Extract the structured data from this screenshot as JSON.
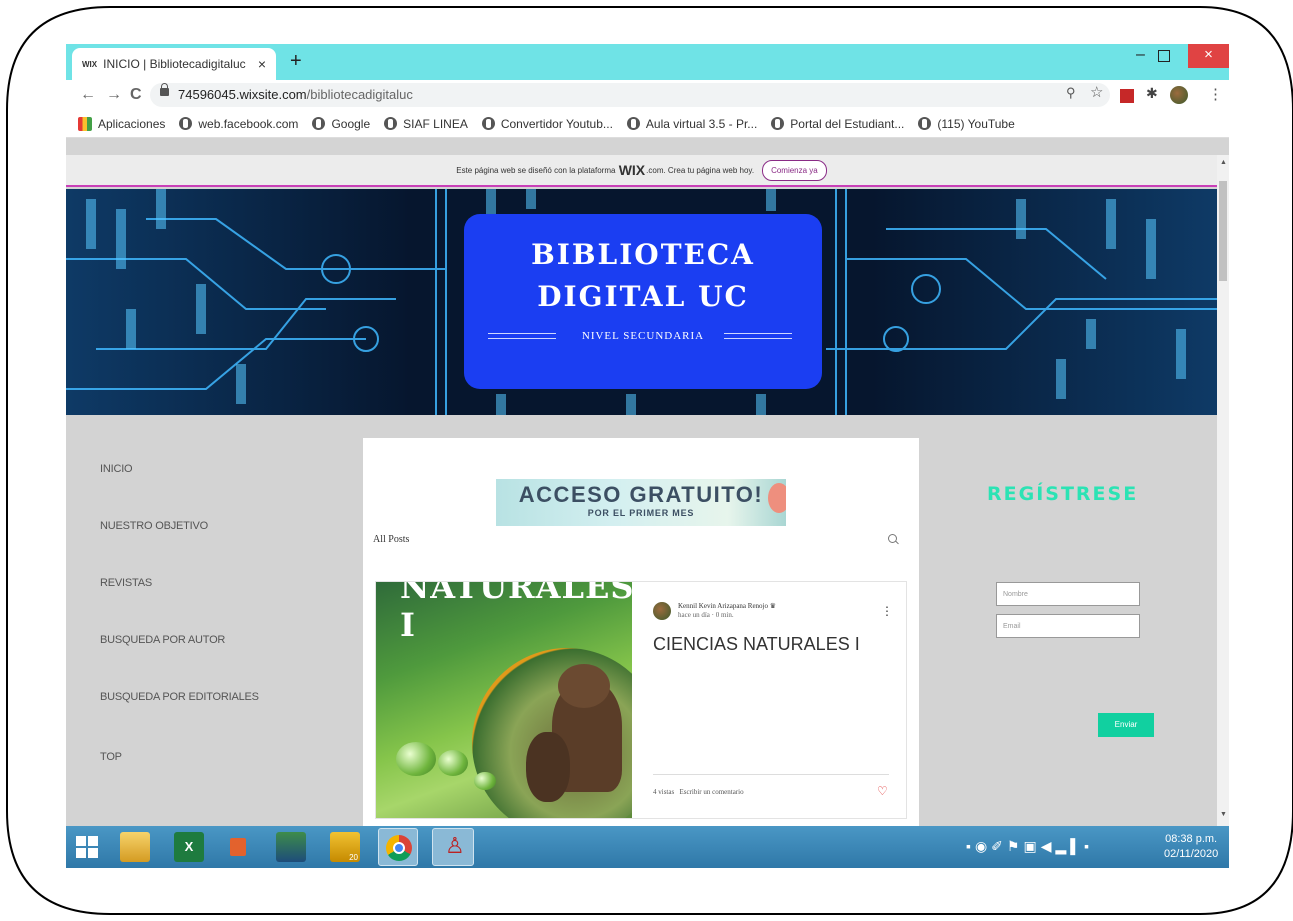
{
  "browser": {
    "tab_title": "INICIO | Bibliotecadigitaluc",
    "tab_favicon": "WIX",
    "tab_close": "×",
    "new_tab": "+",
    "url_host": "74596045.wixsite.com",
    "url_path": "/bibliotecadigitaluc",
    "back_icon": "←",
    "forward_icon": "→",
    "reload_icon": "C",
    "window_minimize": "–",
    "window_close": "×",
    "menu_icon": "⋮",
    "bookmarks": [
      {
        "label": "Aplicaciones",
        "icon": "apps-icon"
      },
      {
        "label": "web.facebook.com",
        "icon": "globe-icon"
      },
      {
        "label": "Google",
        "icon": "globe-icon"
      },
      {
        "label": "SIAF LINEA",
        "icon": "globe-icon"
      },
      {
        "label": "Convertidor Youtub...",
        "icon": "globe-icon"
      },
      {
        "label": "Aula virtual 3.5 - Pr...",
        "icon": "globe-icon"
      },
      {
        "label": "Portal del Estudiant...",
        "icon": "globe-icon"
      },
      {
        "label": "(115) YouTube",
        "icon": "globe-icon"
      }
    ]
  },
  "wix_banner": {
    "text_before": "Este página web se diseñó con la plataforma",
    "brand": "WIX",
    "text_after": ".com. Crea tu página web hoy.",
    "button": "Comienza ya"
  },
  "hero": {
    "title_line1": "BIBLIOTECA",
    "title_line2": "DIGITAL UC",
    "subtitle": "NIVEL SECUNDARIA",
    "card_color": "#1b3ef2"
  },
  "nav": {
    "items": [
      "INICIO",
      "NUESTRO OBJETIVO",
      "REVISTAS",
      "BUSQUEDA POR AUTOR",
      "BUSQUEDA POR EDITORIALES",
      "TOP"
    ]
  },
  "promo": {
    "title": "ACCESO GRATUITO!",
    "subtitle": "POR EL PRIMER MES"
  },
  "blog": {
    "all_posts": "All Posts",
    "post": {
      "image_title": "NATURALES I",
      "author": "Kennil Kevin Arizapana Renojo",
      "meta": "hace un día · 0 min.",
      "title": "CIENCIAS NATURALES I",
      "views": "4 vistas",
      "comment": "Escribir un comentario",
      "menu": "⋮",
      "heart": "♡"
    }
  },
  "register": {
    "title": "REGÍSTRESE",
    "name_placeholder": "Nombre",
    "email_placeholder": "Email",
    "submit": "Enviar",
    "accent": "#2be3b4"
  },
  "taskbar": {
    "time": "08:38 p.m.",
    "date": "02/11/2020",
    "badge": "20"
  }
}
